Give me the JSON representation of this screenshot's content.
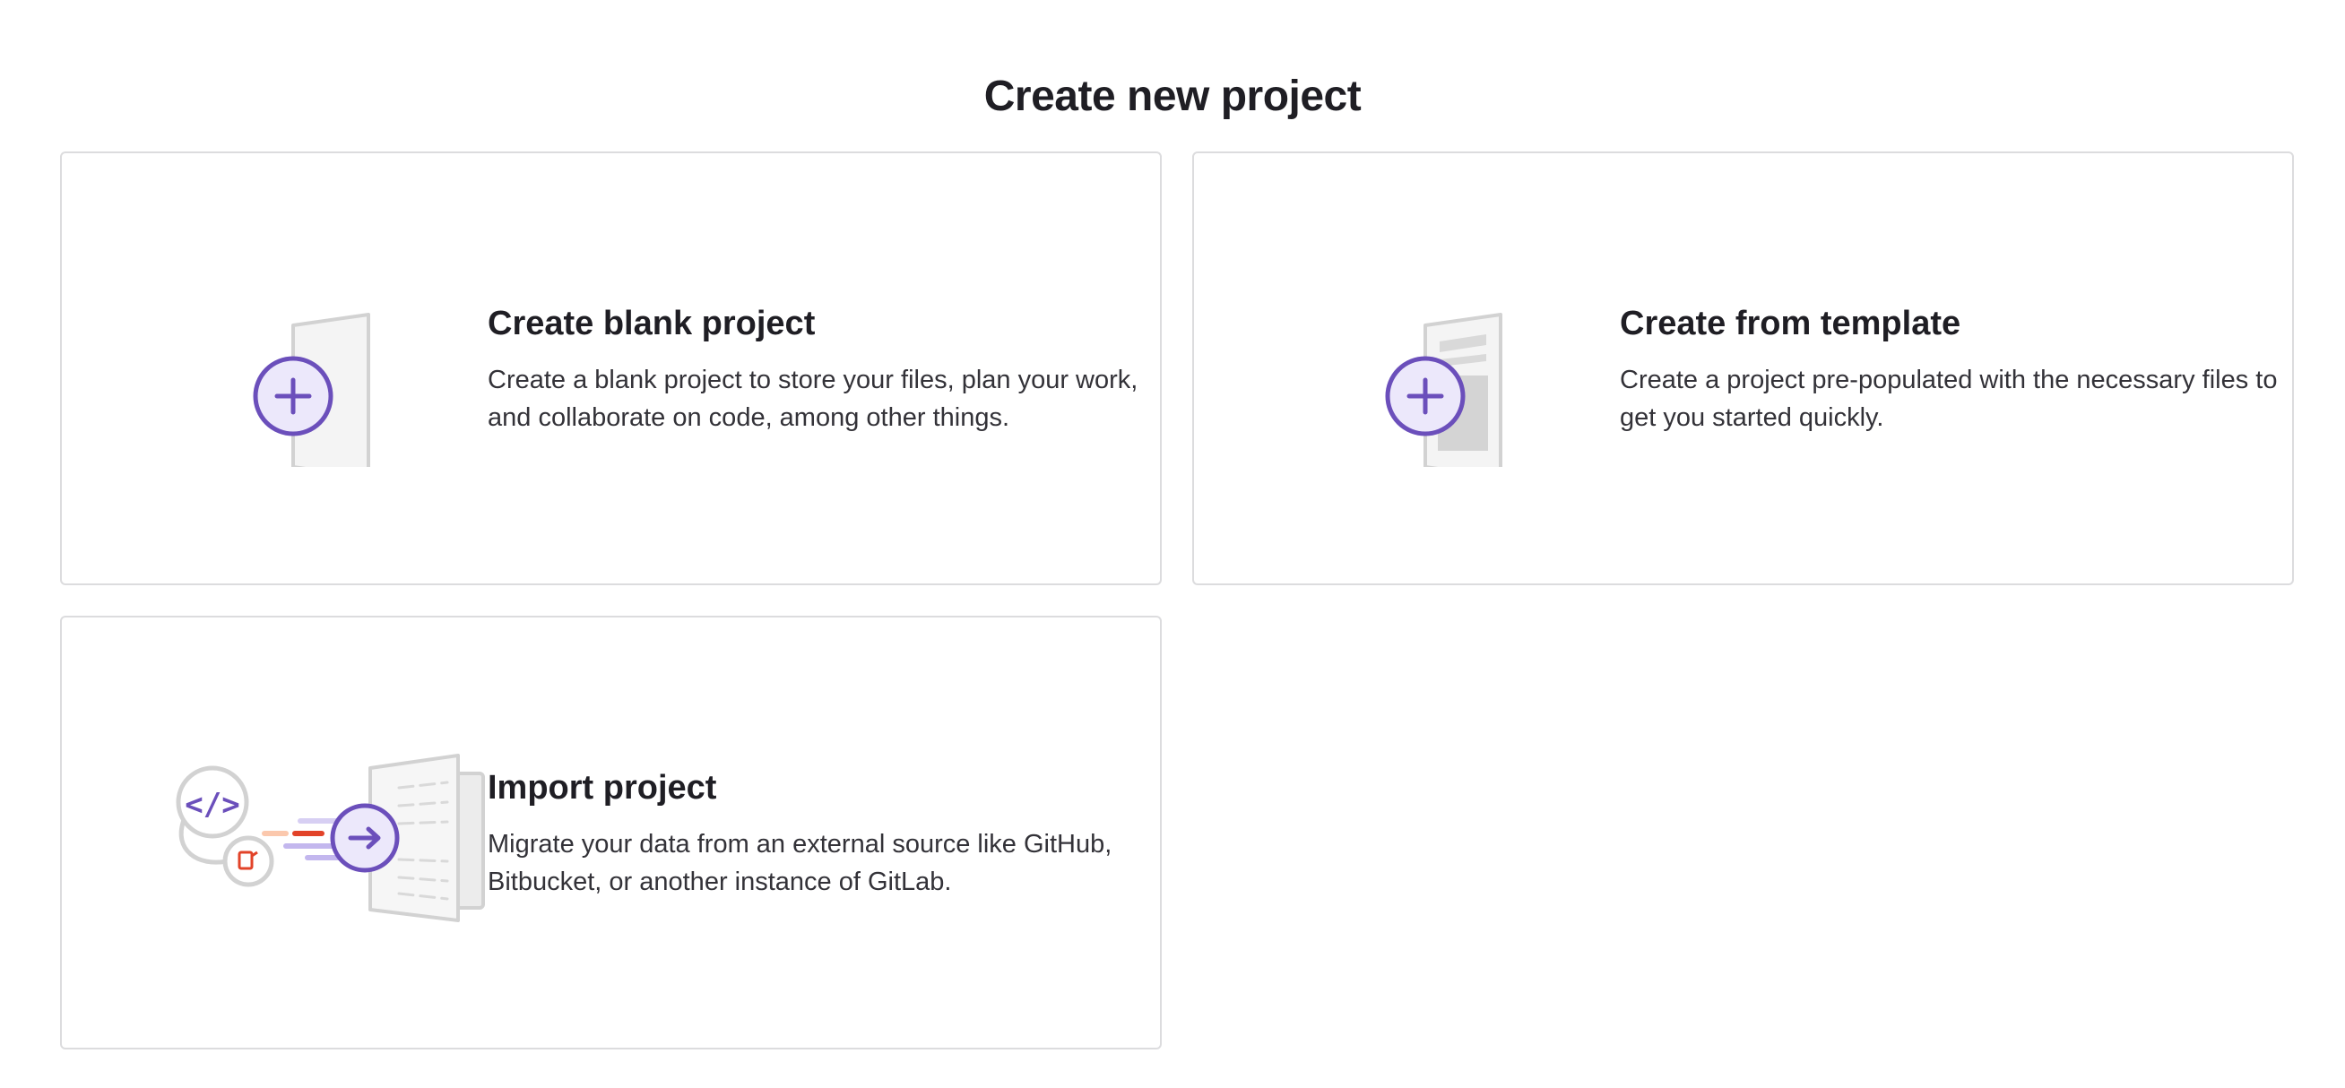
{
  "page": {
    "title": "Create new project"
  },
  "cards": [
    {
      "title": "Create blank project",
      "description": "Create a blank project to store your files, plan your work, and collaborate on code, among other things.",
      "icon": "blank-project-icon"
    },
    {
      "title": "Create from template",
      "description": "Create a project pre-populated with the necessary files to get you started quickly.",
      "icon": "template-project-icon"
    },
    {
      "title": "Import project",
      "description": "Migrate your data from an external source like GitHub, Bitbucket, or another instance of GitLab.",
      "icon": "import-project-icon"
    }
  ],
  "colors": {
    "accent_purple": "#6b4fbb",
    "accent_purple_light": "#ece8fb",
    "accent_orange": "#e24329",
    "border": "#dcdcde",
    "illustration_gray": "#d9d9d9"
  }
}
